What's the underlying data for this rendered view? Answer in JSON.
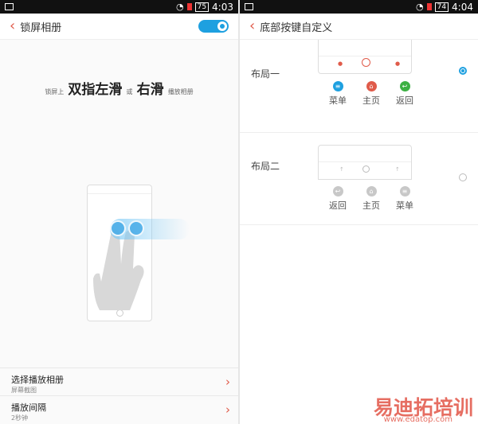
{
  "left": {
    "status": {
      "battery": "75",
      "time": "4:03"
    },
    "header": {
      "title": "锁屏相册",
      "toggle_on": true
    },
    "headline": {
      "p1": "锁屏上",
      "p2": "双指左滑",
      "p3": "或",
      "p4": "右滑",
      "p5": "播放相册"
    },
    "settings": [
      {
        "name": "选择播放相册",
        "sub": "屏幕截图"
      },
      {
        "name": "播放间隔",
        "sub": "2秒钟"
      }
    ]
  },
  "right": {
    "status": {
      "battery": "74",
      "time": "4:04"
    },
    "header": {
      "title": "底部按键自定义"
    },
    "layouts": [
      {
        "name": "布局一",
        "selected": true,
        "buttons": [
          {
            "label": "菜单",
            "icon": "menu-icon",
            "color": "#1ea0e0"
          },
          {
            "label": "主页",
            "icon": "home-icon",
            "color": "#e05b4a"
          },
          {
            "label": "返回",
            "icon": "back-icon",
            "color": "#3cb043"
          }
        ]
      },
      {
        "name": "布局二",
        "selected": false,
        "buttons": [
          {
            "label": "返回",
            "icon": "back-icon",
            "color": "#c8c8c8"
          },
          {
            "label": "主页",
            "icon": "home-icon",
            "color": "#c8c8c8"
          },
          {
            "label": "菜单",
            "icon": "menu-icon",
            "color": "#c8c8c8"
          }
        ]
      }
    ]
  },
  "watermark": {
    "text": "易迪拓培训",
    "url": "www.edatop.com"
  },
  "colors": {
    "accent": "#1ea0e0",
    "back_arrow": "#e05b4a"
  }
}
